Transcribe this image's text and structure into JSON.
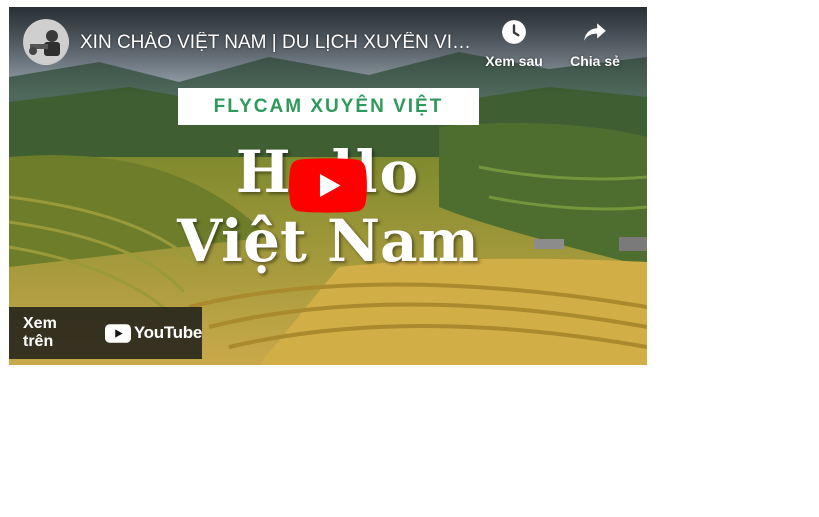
{
  "video": {
    "title": "XIN CHÀO VIỆT NAM | DU LỊCH XUYÊN VIỆT - HELLO VIETNAM",
    "channel_avatar_icon": "channel-avatar",
    "actions": {
      "watch_later": {
        "label": "Xem sau",
        "icon": "clock-icon"
      },
      "share": {
        "label": "Chia sẻ",
        "icon": "share-arrow-icon"
      }
    },
    "thumbnail": {
      "banner_text": "FLYCAM XUYÊN VIỆT",
      "headline_line1": "Hello",
      "headline_line2": "Việt Nam"
    },
    "play_button_icon": "play-icon",
    "watch_on": {
      "label": "Xem trên",
      "logo_text": "YouTube"
    }
  },
  "colors": {
    "banner_text": "#2e9a5b",
    "youtube_red": "#ff0000",
    "overlay_bar": "#171717"
  }
}
